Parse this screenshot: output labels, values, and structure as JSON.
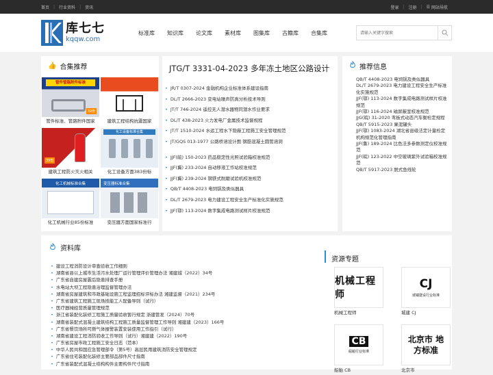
{
  "topbar": {
    "left": [
      "首页",
      "行业资料",
      "资讯"
    ],
    "login": "登录",
    "register": "注册",
    "sitenav": "网站导航"
  },
  "header": {
    "logo_cn": "库七七",
    "logo_en": "kqqw.com",
    "nav": [
      "标准库",
      "知识库",
      "论文库",
      "素材库",
      "图集库",
      "古籍库",
      "合集库"
    ],
    "search_placeholder": "请输入关键字搜索"
  },
  "collections": {
    "title": "合集推荐",
    "items": [
      {
        "caption": "管件标准、管路附件国家",
        "banner": "管件管路附件标准",
        "price": "39份"
      },
      {
        "caption": "建筑工程结构抗震国家"
      },
      {
        "caption": "建筑工程防火灭火相关",
        "price": "39份"
      },
      {
        "caption": "化工设备方面383份标",
        "banner": "化工设备标准合集"
      },
      {
        "caption": "化工机械行业85份标准",
        "banner": "化工机械标准合集"
      },
      {
        "caption": "变压器方面国家标准行",
        "banner": "变压器标准合集"
      }
    ]
  },
  "featured": {
    "title": "JTG/T 3331-04-2023 多年冻土地区公路设计",
    "list1": [
      "JR/T 0307-2024 金融机构企业标准体系建设指南",
      "DL/T 2666-2023 变电站噪声防真分析技术导则",
      "JT/T 746-2024 遥控无人潜水器物同潜水作业要求",
      "DL/T 438-2023 火力发电厂金属技术监督规程",
      "JT/T 1510-2024 水运工程水下隐蔽工程施工安全管理规范",
      "JT/GQS 013-1977 公路桥涵设计图 钢筋混凝土圆管涵洞"
    ],
    "list2": [
      "JJF(皖) 150-2023 药品稳定性光照试验箱校准规范",
      "JJF(冀) 233-2024 自动移液工作站校准规范",
      "JJF(冀) 239-2024 钢铁式耐磨试验机校准规范",
      "QB/T 4408-2023 电饲锅及类似器具",
      "DL/T 2679-2023 电力建设工程安全生产标准化实施规范",
      "JJF(鄂) 113-2024 数字集成电路测试样片校准规范"
    ]
  },
  "recommend": {
    "title": "推荐信息",
    "items": [
      "QB/T 4408-2023 电饲锅及类似器具",
      "DL/T 2679-2023 电力建设工程安全生产标准化实施规范",
      "JJF(鄂) 113-2024 数字集成电路测试样片校准规范",
      "JJF(鄂) 116-2024 磁屏蔽室校准规范",
      "JJG(皖) 31-2020 弯板式动态汽车衡检定规程",
      "QB/T 5915-2023 果泥罐头",
      "JJF(鄂) 1083-2024 湖北省县级法定计量检定机构规范化管理指南",
      "JJF(鲁) 189-2024 比色法多参数测定仪校准规范",
      "JJF(皖) 123-2022 中空玻璃紫外试验箱校准规范",
      "QB/T 5917-2023 脱式鱼线轮"
    ]
  },
  "docs": {
    "title": "资料库",
    "items": [
      "建设工程消防设计审查验收工作细则",
      "湖南省县以上城市生活污水处理厂运行管理评价管理办法 湘建城（2022）34号",
      "广东省自建房屋震后隐患排查手册",
      "水电站大坝工程隐患治理监督管理办法",
      "湖南省房屋建筑和市政基础设施工程监理招标评标办法 湘建监督（2021）234号",
      "广东省建筑工程施工现场技能工人配备导则（试行）",
      "医疗器械经营质量管理规范",
      "浙江省装配化装修工程施工质量验收暂行规定 浙建管发（2024）70号",
      "湖南省装配式混凝土建筑结构工程施工质量监督管理工作导则 湘建建（2023）166号",
      "广东省餐饮场所可燃气体报警装置安装使用工作指引（试行）",
      "湖南省建设工程消防验收工作导则（试行）湘建建（2022）190号",
      "广东省房屋市政工程施工安全日志（范本）",
      "中华人民共和国应急管理部令（第5号）高层民用建筑消防安全管理规定",
      "广东省住宅装配化装修主要部品部件尺寸指南",
      "广东省装配式混凝土结构构件主要构件尺寸指南"
    ]
  },
  "topics": {
    "title": "资源专题",
    "items": [
      {
        "caption": "机械工程师",
        "art": "机械工程师"
      },
      {
        "caption": "城建 CJ",
        "art": "CJ",
        "sub": "城镇建设行业标准"
      },
      {
        "caption": "船舶 CB",
        "art": "CB",
        "sub": "船舶行业标准"
      },
      {
        "caption": "北京市",
        "art": "北京市 地方标准"
      }
    ]
  },
  "colors": {
    "accent": "#2a8bd8",
    "brand": "#2a6fb3"
  }
}
